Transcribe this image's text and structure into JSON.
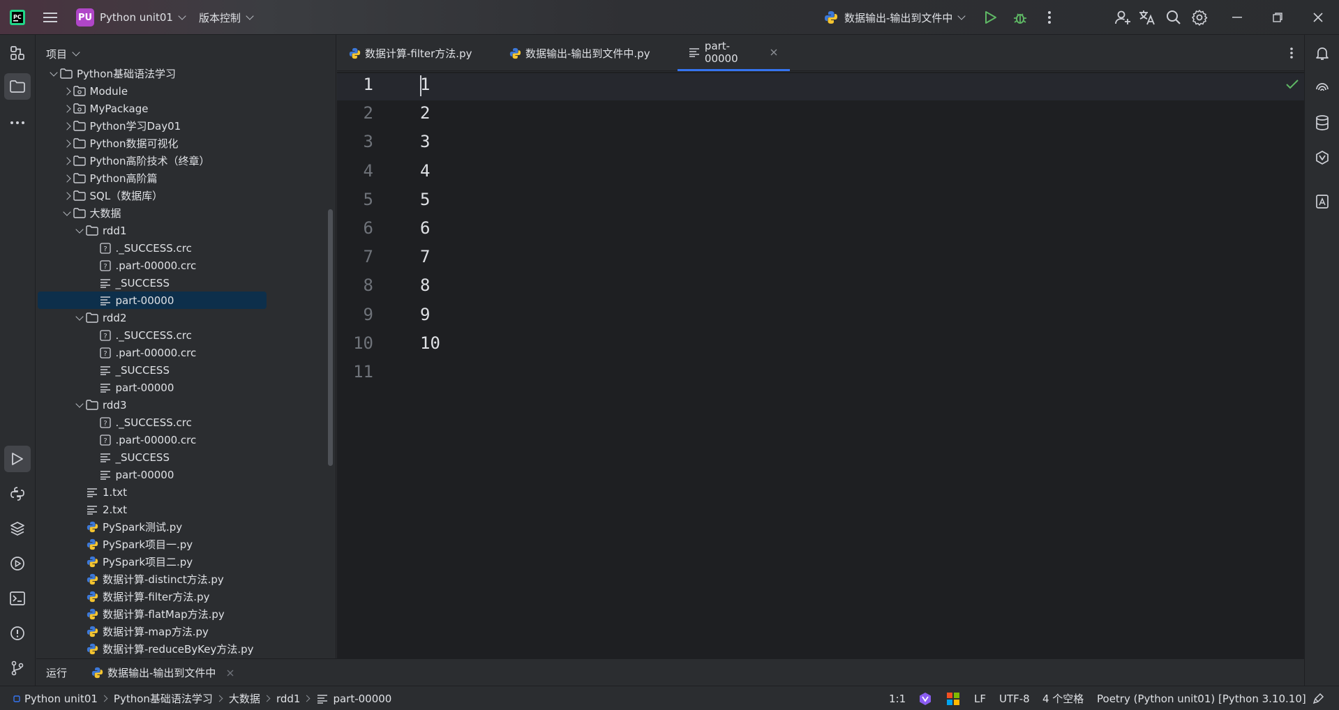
{
  "titlebar": {
    "project_badge": "PU",
    "project_name": "Python unit01",
    "vcs": "版本控制",
    "run_config": "数据输出-输出到文件中"
  },
  "project_panel": {
    "title": "项目",
    "tree": [
      {
        "label": "Python基础语法学习",
        "depth": 0,
        "kind": "folder",
        "expanded": true
      },
      {
        "label": "Module",
        "depth": 1,
        "kind": "module",
        "expanded": false
      },
      {
        "label": "MyPackage",
        "depth": 1,
        "kind": "module",
        "expanded": false
      },
      {
        "label": "Python学习Day01",
        "depth": 1,
        "kind": "folder",
        "expanded": false
      },
      {
        "label": "Python数据可视化",
        "depth": 1,
        "kind": "folder",
        "expanded": false
      },
      {
        "label": "Python高阶技术（终章）",
        "depth": 1,
        "kind": "folder",
        "expanded": false
      },
      {
        "label": "Python高阶篇",
        "depth": 1,
        "kind": "folder",
        "expanded": false
      },
      {
        "label": "SQL（数据库）",
        "depth": 1,
        "kind": "folder",
        "expanded": false
      },
      {
        "label": "大数据",
        "depth": 1,
        "kind": "folder",
        "expanded": true
      },
      {
        "label": "rdd1",
        "depth": 2,
        "kind": "folder",
        "expanded": true
      },
      {
        "label": "._SUCCESS.crc",
        "depth": 3,
        "kind": "unknown"
      },
      {
        "label": ".part-00000.crc",
        "depth": 3,
        "kind": "unknown"
      },
      {
        "label": "_SUCCESS",
        "depth": 3,
        "kind": "text"
      },
      {
        "label": "part-00000",
        "depth": 3,
        "kind": "text",
        "selected": true
      },
      {
        "label": "rdd2",
        "depth": 2,
        "kind": "folder",
        "expanded": true
      },
      {
        "label": "._SUCCESS.crc",
        "depth": 3,
        "kind": "unknown"
      },
      {
        "label": ".part-00000.crc",
        "depth": 3,
        "kind": "unknown"
      },
      {
        "label": "_SUCCESS",
        "depth": 3,
        "kind": "text"
      },
      {
        "label": "part-00000",
        "depth": 3,
        "kind": "text"
      },
      {
        "label": "rdd3",
        "depth": 2,
        "kind": "folder",
        "expanded": true
      },
      {
        "label": "._SUCCESS.crc",
        "depth": 3,
        "kind": "unknown"
      },
      {
        "label": ".part-00000.crc",
        "depth": 3,
        "kind": "unknown"
      },
      {
        "label": "_SUCCESS",
        "depth": 3,
        "kind": "text"
      },
      {
        "label": "part-00000",
        "depth": 3,
        "kind": "text"
      },
      {
        "label": "1.txt",
        "depth": 2,
        "kind": "text"
      },
      {
        "label": "2.txt",
        "depth": 2,
        "kind": "text"
      },
      {
        "label": "PySpark测试.py",
        "depth": 2,
        "kind": "python"
      },
      {
        "label": "PySpark项目一.py",
        "depth": 2,
        "kind": "python"
      },
      {
        "label": "PySpark项目二.py",
        "depth": 2,
        "kind": "python"
      },
      {
        "label": "数据计算-distinct方法.py",
        "depth": 2,
        "kind": "python"
      },
      {
        "label": "数据计算-filter方法.py",
        "depth": 2,
        "kind": "python"
      },
      {
        "label": "数据计算-flatMap方法.py",
        "depth": 2,
        "kind": "python"
      },
      {
        "label": "数据计算-map方法.py",
        "depth": 2,
        "kind": "python"
      },
      {
        "label": "数据计算-reduceByKey方法.py",
        "depth": 2,
        "kind": "python"
      }
    ]
  },
  "tabs": [
    {
      "label": "数据计算-filter方法.py",
      "kind": "python",
      "active": false
    },
    {
      "label": "数据输出-输出到文件中.py",
      "kind": "python",
      "active": false
    },
    {
      "label": "part-00000",
      "kind": "text",
      "active": true
    }
  ],
  "editor": {
    "line_numbers": [
      "1",
      "2",
      "3",
      "4",
      "5",
      "6",
      "7",
      "8",
      "9",
      "10",
      "11"
    ],
    "lines": [
      "1",
      "2",
      "3",
      "4",
      "5",
      "6",
      "7",
      "8",
      "9",
      "10",
      ""
    ]
  },
  "runbar": {
    "label": "运行",
    "config": "数据输出-输出到文件中"
  },
  "statusbar": {
    "breadcrumb": [
      "Python unit01",
      "Python基础语法学习",
      "大数据",
      "rdd1",
      "part-00000"
    ],
    "position": "1:1",
    "line_sep": "LF",
    "encoding": "UTF-8",
    "indent": "4 个空格",
    "interpreter": "Poetry (Python unit01) [Python 3.10.10]"
  },
  "colors": {
    "accent": "#3574f0",
    "selection": "#0d2f4b",
    "run_green": "#5fb865",
    "badge": "#b046c8"
  }
}
